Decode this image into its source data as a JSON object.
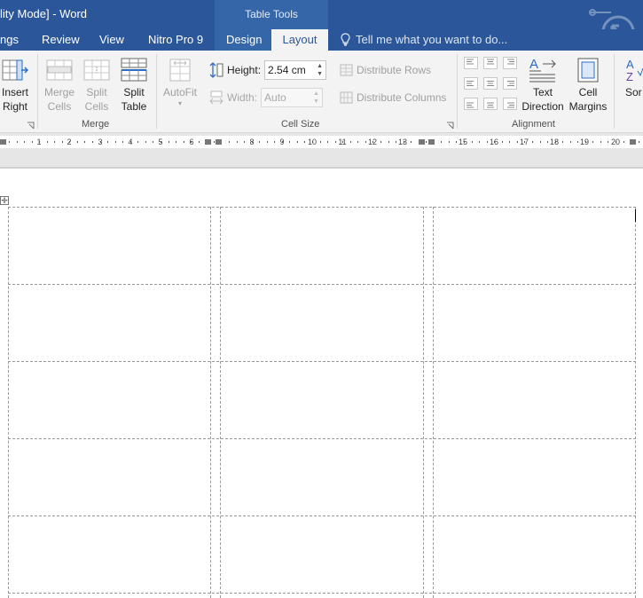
{
  "window": {
    "title_fragment": "lity Mode] - Word",
    "context_header": "Table Tools"
  },
  "tabs": [
    {
      "label": "ngs",
      "active": false
    },
    {
      "label": "Review",
      "active": false
    },
    {
      "label": "View",
      "active": false
    },
    {
      "label": "Nitro Pro 9",
      "active": false
    },
    {
      "label": "Design",
      "active": false
    },
    {
      "label": "Layout",
      "active": true
    }
  ],
  "tell_me": {
    "placeholder": "Tell me what you want to do...",
    "icon": "lightbulb-icon"
  },
  "ribbon": {
    "insert_right": {
      "line1": "Insert",
      "line2": "Right",
      "icon": "insert-column-right-icon"
    },
    "merge_group": {
      "label": "Merge",
      "merge_cells": {
        "line1": "Merge",
        "line2": "Cells",
        "enabled": false,
        "icon": "merge-cells-icon"
      },
      "split_cells": {
        "line1": "Split",
        "line2": "Cells",
        "enabled": false,
        "icon": "split-cells-icon"
      },
      "split_table": {
        "line1": "Split",
        "line2": "Table",
        "enabled": true,
        "icon": "split-table-icon"
      }
    },
    "cell_size_group": {
      "label": "Cell Size",
      "autofit": {
        "label": "AutoFit",
        "enabled": false,
        "icon": "autofit-icon"
      },
      "height": {
        "label": "Height:",
        "value": "2.54 cm",
        "enabled": true,
        "icon": "row-height-icon"
      },
      "width": {
        "label": "Width:",
        "value": "Auto",
        "enabled": false,
        "icon": "column-width-icon"
      },
      "distribute_rows": {
        "label": "Distribute Rows",
        "enabled": false,
        "icon": "distribute-rows-icon"
      },
      "distribute_columns": {
        "label": "Distribute Columns",
        "enabled": false,
        "icon": "distribute-columns-icon"
      }
    },
    "alignment_group": {
      "label": "Alignment",
      "cell_alignments": [
        "top-left",
        "top-center",
        "top-right",
        "middle-left",
        "middle-center",
        "middle-right",
        "bottom-left",
        "bottom-center",
        "bottom-right"
      ],
      "text_direction": {
        "line1": "Text",
        "line2": "Direction",
        "icon": "text-direction-icon"
      },
      "cell_margins": {
        "line1": "Cell",
        "line2": "Margins",
        "icon": "cell-margins-icon"
      },
      "sort": {
        "label": "Sor",
        "icon": "sort-az-icon"
      }
    }
  },
  "ruler": {
    "numbers": [
      "1",
      "2",
      "3",
      "4",
      "5",
      "6",
      "8",
      "9",
      "10",
      "11",
      "12",
      "13",
      "15",
      "16",
      "17",
      "18",
      "19",
      "20"
    ]
  },
  "document": {
    "table": {
      "rows": 5,
      "columns": 3,
      "cells_text": [
        [
          "",
          "",
          ""
        ],
        [
          "",
          "",
          ""
        ],
        [
          "",
          "",
          ""
        ],
        [
          "",
          "",
          ""
        ],
        [
          "",
          "",
          ""
        ]
      ]
    }
  },
  "colors": {
    "title_bar": "#2b579a",
    "context_band": "#3566a8",
    "ribbon_bg": "#f3f3f3",
    "active_tab_text": "#2b579a",
    "gridline": "#999999"
  }
}
